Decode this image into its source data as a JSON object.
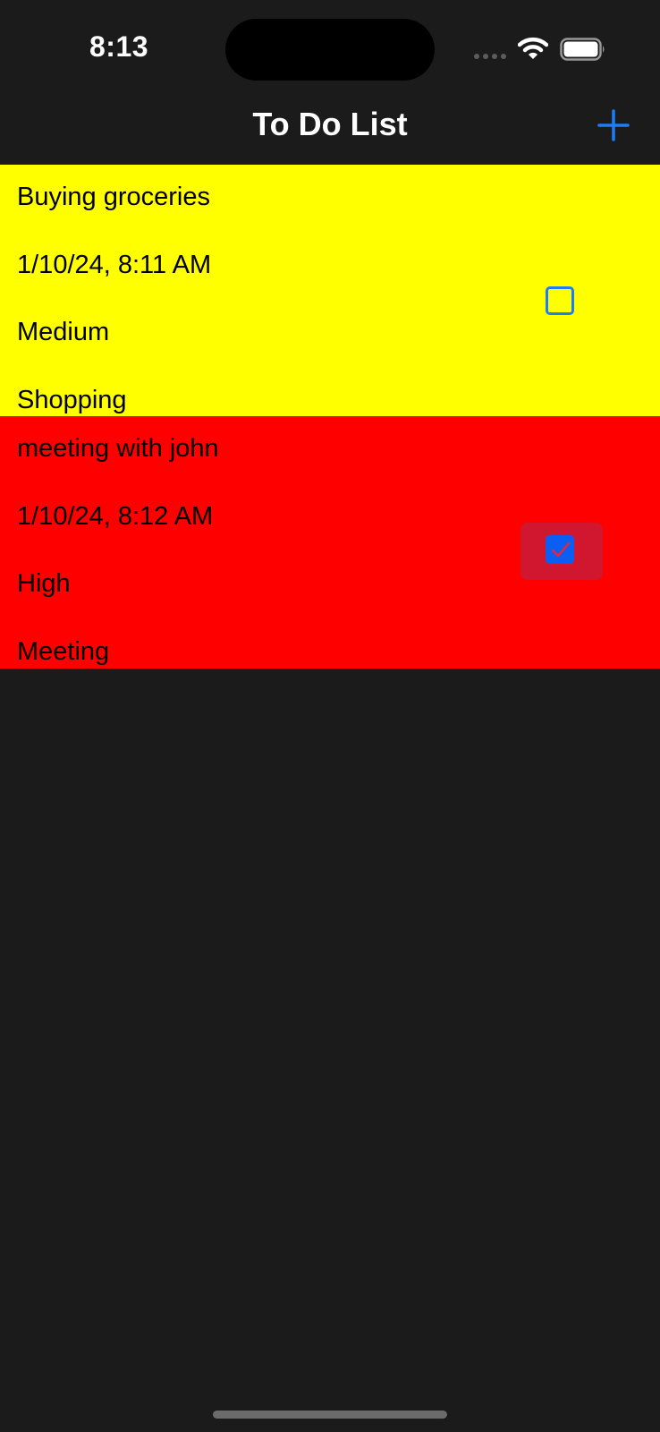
{
  "status_bar": {
    "time": "8:13",
    "signal_icon": "cellular-dots-icon",
    "wifi_icon": "wifi-icon",
    "battery_icon": "battery-icon"
  },
  "nav": {
    "title": "To Do List",
    "add_icon": "plus-icon"
  },
  "colors": {
    "background": "#1b1b1b",
    "accent": "#1e7cf5",
    "priority_medium": "#ffff00",
    "priority_high": "#ff0000"
  },
  "todos": [
    {
      "title": "Buying groceries",
      "date": "1/10/24, 8:11 AM",
      "priority": "Medium",
      "category": "Shopping",
      "completed": false,
      "row_color": "#ffff00"
    },
    {
      "title": "meeting with john",
      "date": "1/10/24, 8:12 AM",
      "priority": "High",
      "category": "Meeting",
      "completed": true,
      "row_color": "#ff0000"
    }
  ]
}
